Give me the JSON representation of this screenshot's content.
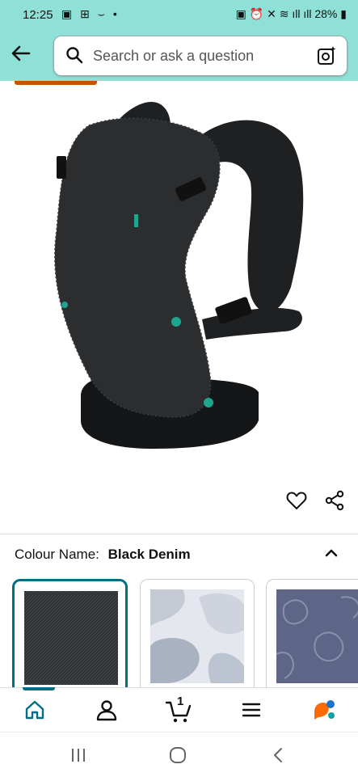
{
  "status_bar": {
    "time": "12:25",
    "left_icons": "▣ ⊞ ⌣ •",
    "right_icons": "▣ ⏰ ✕ ≋ ıll ıll",
    "battery": "28%"
  },
  "header": {
    "search_placeholder": "Search or ask a question"
  },
  "product": {
    "image_name": "baby-carrier-black-denim",
    "carousel_count": 5,
    "carousel_active_index": 2
  },
  "variation": {
    "label": "Colour Name:",
    "value": "Black Denim"
  },
  "swatches": [
    {
      "name": "Black Denim",
      "selected": true
    },
    {
      "name": "Grey Pattern",
      "selected": false
    },
    {
      "name": "Blue Floral",
      "selected": false
    }
  ],
  "bottom_nav": {
    "items": [
      "home",
      "account",
      "cart",
      "menu",
      "rufus"
    ],
    "cart_count": "1",
    "active": "home"
  },
  "colors": {
    "header_bg": "#8fe0d6",
    "accent": "#007185",
    "orange": "#c45500",
    "carrier": "#2b2d2f"
  }
}
